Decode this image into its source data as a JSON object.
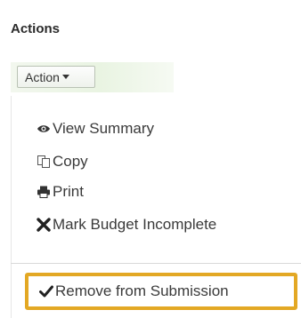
{
  "panel": {
    "heading": "Actions"
  },
  "action_button": {
    "label": "Action"
  },
  "menu": {
    "items": [
      {
        "label": "View Summary",
        "icon": "eye-icon"
      },
      {
        "label": "Copy",
        "icon": "copy-icon"
      },
      {
        "label": "Print",
        "icon": "print-icon"
      },
      {
        "label": "Mark Budget Incomplete",
        "icon": "x-icon"
      }
    ],
    "highlighted_item": {
      "label": "Remove from Submission",
      "icon": "checkmark-icon"
    }
  },
  "colors": {
    "highlight_border": "#e3a824",
    "action_bar_bg": "#e9f4e2",
    "text": "#3a3a3a"
  }
}
